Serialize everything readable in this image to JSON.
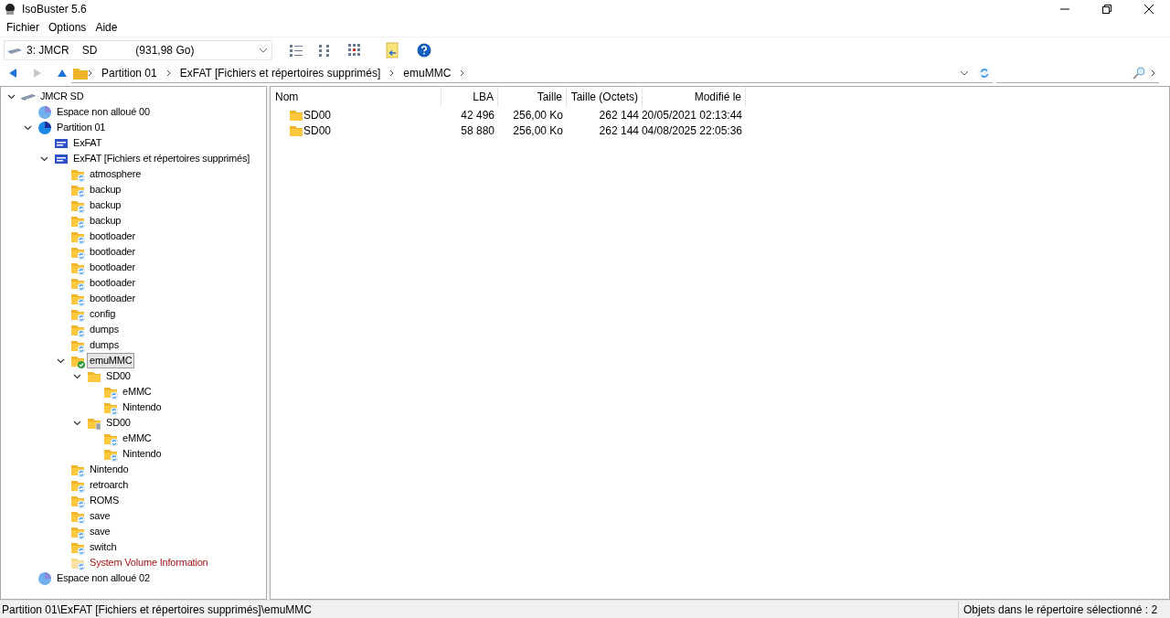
{
  "window": {
    "title": "IsoBuster 5.6"
  },
  "menu": [
    "Fichier",
    "Options",
    "Aide"
  ],
  "device": {
    "id": "3: JMCR",
    "type": "SD",
    "size": "(931,98 Go)"
  },
  "breadcrumb": [
    "Partition 01",
    "ExFAT [Fichiers et répertoires supprimés]",
    "emuMMC"
  ],
  "tree": [
    {
      "label": "JMCR SD",
      "kind": "drive",
      "expanded": true,
      "selected": false,
      "children": [
        {
          "label": "Espace non alloué 00",
          "kind": "pie-light",
          "selected": false
        },
        {
          "label": "Partition 01",
          "kind": "pie",
          "expanded": true,
          "selected": false,
          "children": [
            {
              "label": "ExFAT",
              "kind": "fs",
              "selected": false
            },
            {
              "label": "ExFAT [Fichiers et répertoires supprimés]",
              "kind": "fs",
              "expanded": true,
              "selected": false,
              "children": [
                {
                  "label": "atmosphere",
                  "kind": "folder-deleted",
                  "selected": false
                },
                {
                  "label": "backup",
                  "kind": "folder-deleted",
                  "selected": false
                },
                {
                  "label": "backup",
                  "kind": "folder-deleted",
                  "selected": false
                },
                {
                  "label": "backup",
                  "kind": "folder-deleted",
                  "selected": false
                },
                {
                  "label": "bootloader",
                  "kind": "folder-deleted",
                  "selected": false
                },
                {
                  "label": "bootloader",
                  "kind": "folder-deleted",
                  "selected": false
                },
                {
                  "label": "bootloader",
                  "kind": "folder-deleted",
                  "selected": false
                },
                {
                  "label": "bootloader",
                  "kind": "folder-deleted",
                  "selected": false
                },
                {
                  "label": "bootloader",
                  "kind": "folder-deleted",
                  "selected": false
                },
                {
                  "label": "config",
                  "kind": "folder-deleted",
                  "selected": false
                },
                {
                  "label": "dumps",
                  "kind": "folder-deleted",
                  "selected": false
                },
                {
                  "label": "dumps",
                  "kind": "folder-deleted",
                  "selected": false
                },
                {
                  "label": "emuMMC",
                  "kind": "folder-ok",
                  "expanded": true,
                  "selected": true,
                  "children": [
                    {
                      "label": "SD00",
                      "kind": "folder",
                      "expanded": true,
                      "selected": false,
                      "children": [
                        {
                          "label": "eMMC",
                          "kind": "folder-deleted",
                          "selected": false
                        },
                        {
                          "label": "Nintendo",
                          "kind": "folder-deleted",
                          "selected": false
                        }
                      ]
                    },
                    {
                      "label": "SD00",
                      "kind": "folder-trash",
                      "expanded": true,
                      "selected": false,
                      "children": [
                        {
                          "label": "eMMC",
                          "kind": "folder-deleted",
                          "selected": false
                        },
                        {
                          "label": "Nintendo",
                          "kind": "folder-deleted",
                          "selected": false
                        }
                      ]
                    }
                  ]
                },
                {
                  "label": "Nintendo",
                  "kind": "folder-deleted",
                  "selected": false
                },
                {
                  "label": "retroarch",
                  "kind": "folder-deleted",
                  "selected": false
                },
                {
                  "label": "ROMS",
                  "kind": "folder-deleted",
                  "selected": false
                },
                {
                  "label": "save",
                  "kind": "folder-deleted",
                  "selected": false
                },
                {
                  "label": "save",
                  "kind": "folder-deleted",
                  "selected": false
                },
                {
                  "label": "switch",
                  "kind": "folder-deleted",
                  "selected": false
                },
                {
                  "label": "System Volume Information",
                  "kind": "folder-system",
                  "selected": false
                }
              ]
            }
          ]
        },
        {
          "label": "Espace non alloué 02",
          "kind": "pie-light",
          "selected": false
        }
      ]
    }
  ],
  "table": {
    "columns": [
      "Nom",
      "LBA",
      "Taille",
      "Taille (Octets)",
      "Modifié le"
    ],
    "rows": [
      [
        "SD00",
        "42 496",
        "256,00 Ko",
        "262 144",
        "20/05/2021 02:13:44"
      ],
      [
        "SD00",
        "58 880",
        "256,00 Ko",
        "262 144",
        "04/08/2025 22:05:36"
      ]
    ]
  },
  "status_bar": {
    "path": "Partition 01\\ExFAT [Fichiers et répertoires supprimés]\\emuMMC",
    "count": "Objets dans le répertoire sélectionné : 2"
  }
}
